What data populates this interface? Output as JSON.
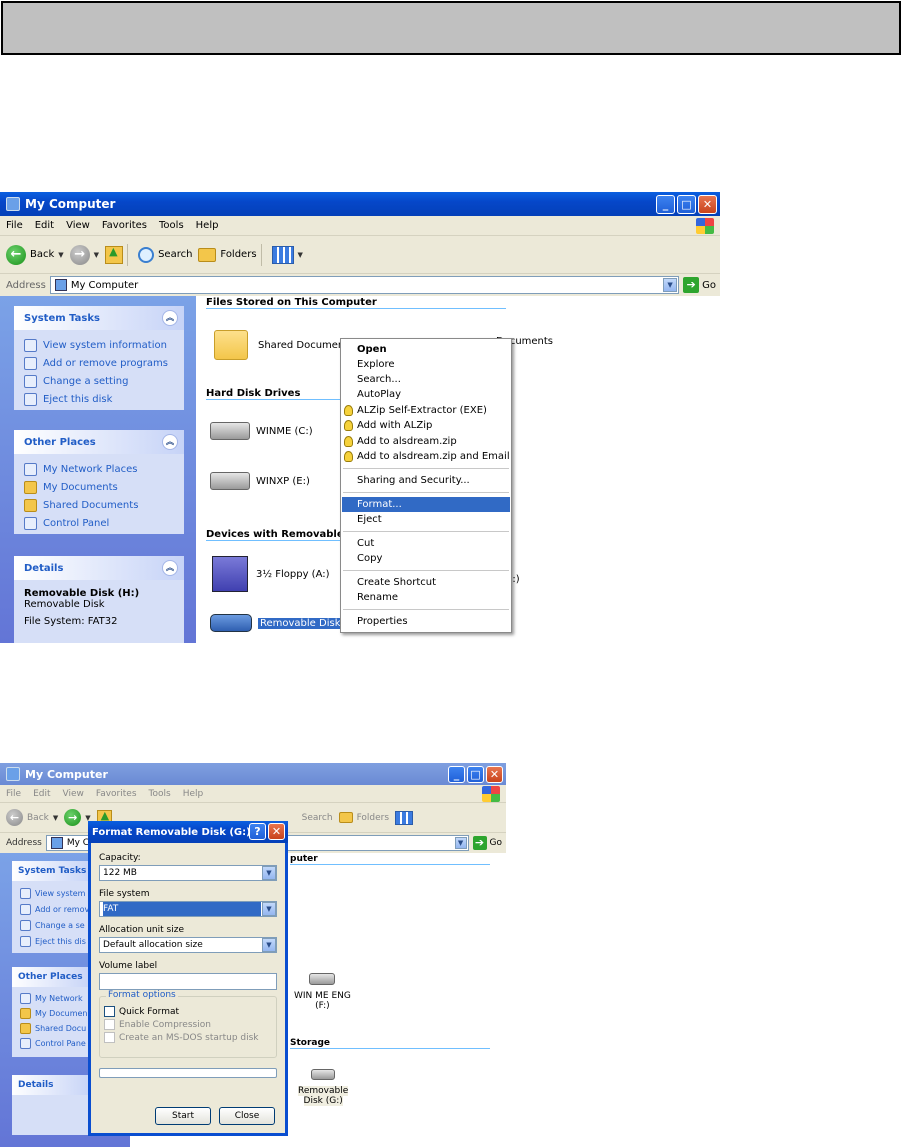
{
  "window1": {
    "title": "My Computer",
    "menu": [
      "File",
      "Edit",
      "View",
      "Favorites",
      "Tools",
      "Help"
    ],
    "toolbar": {
      "back": "Back",
      "search": "Search",
      "folders": "Folders"
    },
    "address": {
      "label": "Address",
      "value": "My Computer",
      "go": "Go"
    },
    "system_tasks": {
      "title": "System Tasks",
      "items": [
        "View system information",
        "Add or remove programs",
        "Change a setting",
        "Eject this disk"
      ]
    },
    "other_places": {
      "title": "Other Places",
      "items": [
        "My Network Places",
        "My Documents",
        "Shared Documents",
        "Control Panel"
      ]
    },
    "details": {
      "title": "Details",
      "name": "Removable Disk (H:)",
      "type": "Removable Disk",
      "fs": "File System: FAT32"
    },
    "groups": {
      "files": "Files Stored on This Computer",
      "hdd": "Hard Disk Drives",
      "removable": "Devices with Removable S"
    },
    "items": {
      "shared_docs": "Shared Documents",
      "documents_partial": "Documents",
      "winme": "WINME (C:)",
      "winxp": "WINXP (E:)",
      "floppy": "3½ Floppy (A:)",
      "removable_partial": "Removable Disk (H:)",
      "partial_e": "E:)"
    },
    "context_menu": {
      "open": "Open",
      "explore": "Explore",
      "search": "Search...",
      "autoplay": "AutoPlay",
      "alzip_sfx": "ALZip Self-Extractor (EXE)",
      "add_alzip": "Add with ALZip",
      "add_zip": "Add to alsdream.zip",
      "add_zip_email": "Add to alsdream.zip and Email",
      "sharing": "Sharing and Security...",
      "format": "Format...",
      "eject": "Eject",
      "cut": "Cut",
      "copy": "Copy",
      "shortcut": "Create Shortcut",
      "rename": "Rename",
      "properties": "Properties"
    }
  },
  "window2": {
    "title": "My Computer",
    "menu": [
      "File",
      "Edit",
      "View",
      "Favorites",
      "Tools",
      "Help"
    ],
    "toolbar": {
      "back": "Back",
      "search": "Search",
      "folders": "Folders"
    },
    "address": {
      "label": "Address",
      "value": "My Compu",
      "go": "Go"
    },
    "system_tasks": {
      "title": "System Tasks",
      "items": [
        "View system",
        "Add or remov",
        "Change a se",
        "Eject this dis"
      ]
    },
    "other_places": {
      "title": "Other Places",
      "items": [
        "My Network",
        "My Documen",
        "Shared Docu",
        "Control Pane"
      ]
    },
    "details": {
      "title": "Details"
    },
    "groups": {
      "computer_partial": "puter",
      "storage_partial": "Storage"
    },
    "items": {
      "winme_eng_1": "WIN ME ENG",
      "winme_eng_2": "(F:)",
      "removable_1": "Removable",
      "removable_2": "Disk (G:)"
    }
  },
  "format_dialog": {
    "title": "Format Removable Disk (G:)",
    "capacity_label": "Capacity:",
    "capacity_value": "122 MB",
    "fs_label": "File system",
    "fs_value": "FAT",
    "alloc_label": "Allocation unit size",
    "alloc_value": "Default allocation size",
    "volume_label": "Volume label",
    "volume_value": "",
    "options_title": "Format options",
    "quick": "Quick Format",
    "compress": "Enable Compression",
    "msdos": "Create an MS-DOS startup disk",
    "start": "Start",
    "close": "Close"
  }
}
